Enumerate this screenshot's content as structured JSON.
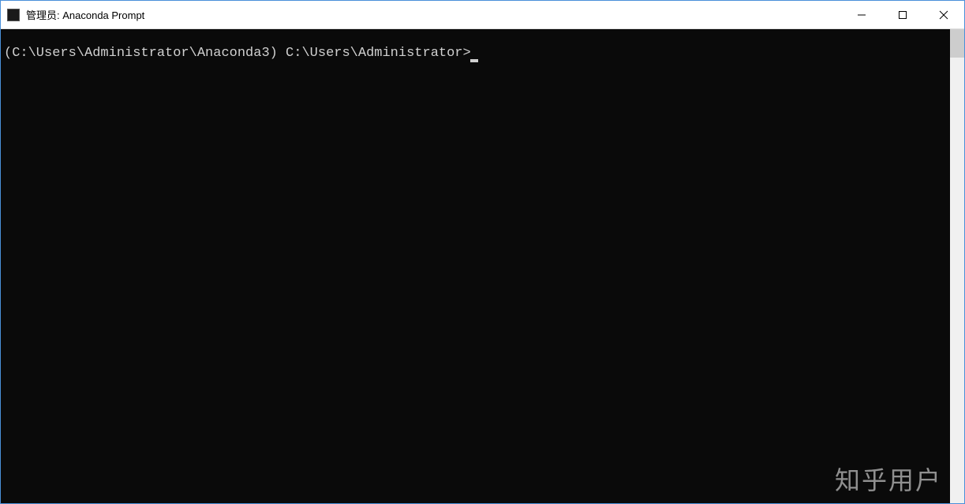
{
  "window": {
    "title": "管理员: Anaconda Prompt"
  },
  "terminal": {
    "prompt": "(C:\\Users\\Administrator\\Anaconda3) C:\\Users\\Administrator>"
  },
  "watermark": {
    "text": "知乎用户"
  }
}
